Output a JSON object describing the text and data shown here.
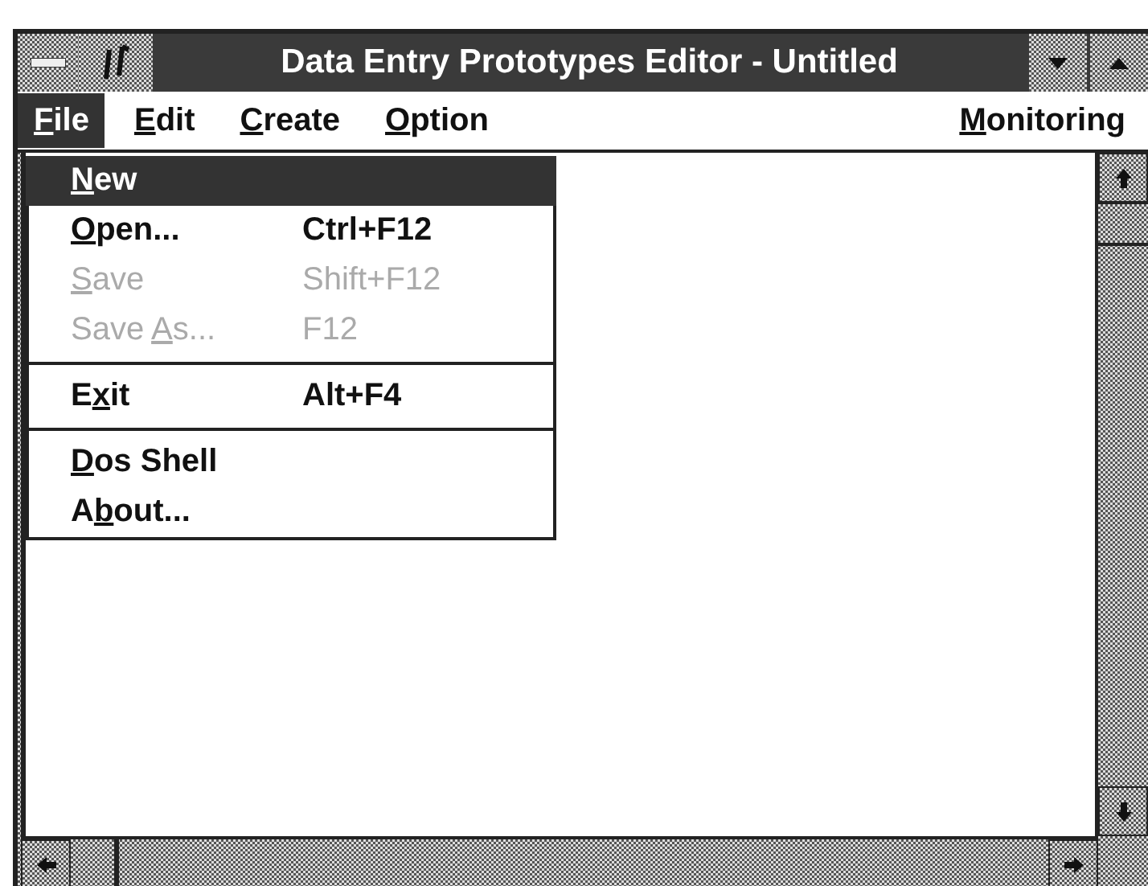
{
  "window": {
    "title": "Data Entry Prototypes Editor - Untitled"
  },
  "menu_bar": [
    {
      "key": "F",
      "after": "ile",
      "selected": true
    },
    {
      "key": "E",
      "after": "dit",
      "selected": false
    },
    {
      "key": "C",
      "after": "reate",
      "selected": false
    },
    {
      "key": "O",
      "after": "ption",
      "selected": false
    },
    {
      "key": "M",
      "after": "onitoring",
      "selected": false
    }
  ],
  "file_menu": [
    {
      "kind": "item",
      "key": "N",
      "after": "ew",
      "selected": true,
      "disabled": false
    },
    {
      "kind": "item",
      "key": "O",
      "after": "pen...",
      "shortcut": "Ctrl+F12",
      "selected": false,
      "disabled": false
    },
    {
      "kind": "item",
      "key": "S",
      "after": "ave",
      "shortcut": "Shift+F12",
      "selected": false,
      "disabled": true
    },
    {
      "kind": "item",
      "before": "Save ",
      "key": "A",
      "after": "s...",
      "shortcut": "F12",
      "selected": false,
      "disabled": true
    },
    {
      "kind": "separator"
    },
    {
      "kind": "item",
      "before": "E",
      "key": "x",
      "after": "it",
      "shortcut": "Alt+F4",
      "selected": false,
      "disabled": false
    },
    {
      "kind": "separator"
    },
    {
      "kind": "item",
      "key": "D",
      "after": "os Shell",
      "selected": false,
      "disabled": false
    },
    {
      "kind": "item",
      "before": "A",
      "key": "b",
      "after": "out...",
      "selected": false,
      "disabled": false
    }
  ]
}
